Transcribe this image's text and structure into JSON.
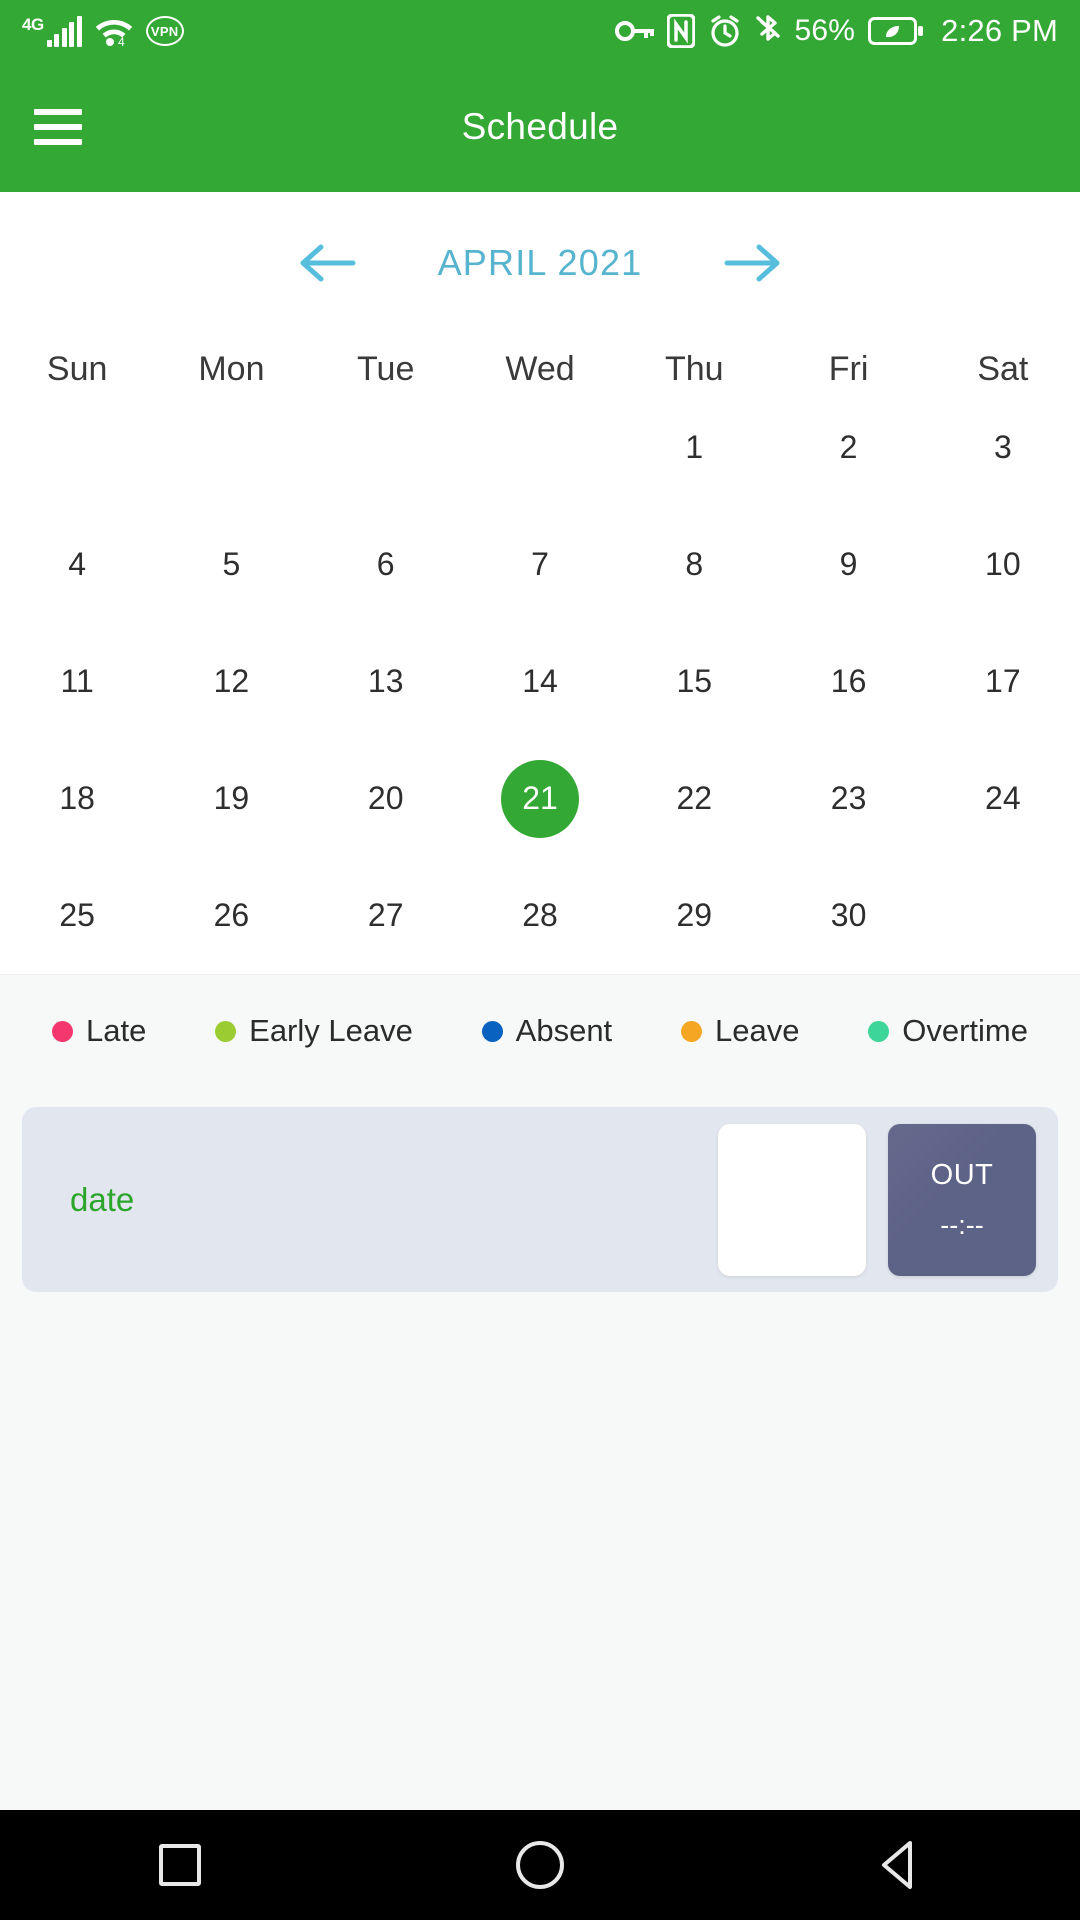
{
  "status_bar": {
    "network_type": "4G",
    "signal_icon": "signal-bars-icon",
    "wifi_icon": "wifi-icon",
    "wifi_badge": "4",
    "vpn_label": "VPN",
    "key_icon": "vpn-key-icon",
    "nfc_icon": "nfc-icon",
    "alarm_icon": "alarm-clock-icon",
    "bluetooth_icon": "bluetooth-icon",
    "battery_percent": "56%",
    "battery_icon": "battery-saver-leaf-icon",
    "time": "2:26 PM"
  },
  "app_bar": {
    "menu_icon": "hamburger-menu-icon",
    "title": "Schedule",
    "background_color": "#34A834"
  },
  "calendar": {
    "prev_icon": "arrow-left-icon",
    "next_icon": "arrow-right-icon",
    "month_label": "APRIL 2021",
    "month_color": "#56B4CE",
    "weekdays": [
      "Sun",
      "Mon",
      "Tue",
      "Wed",
      "Thu",
      "Fri",
      "Sat"
    ],
    "today": 21,
    "today_highlight_color": "#34A834",
    "weeks": [
      [
        "",
        "",
        "",
        "",
        "1",
        "2",
        "3"
      ],
      [
        "4",
        "5",
        "6",
        "7",
        "8",
        "9",
        "10"
      ],
      [
        "11",
        "12",
        "13",
        "14",
        "15",
        "16",
        "17"
      ],
      [
        "18",
        "19",
        "20",
        "21",
        "22",
        "23",
        "24"
      ],
      [
        "25",
        "26",
        "27",
        "28",
        "29",
        "30",
        ""
      ]
    ]
  },
  "legend": [
    {
      "label": "Late",
      "color": "#F4376D"
    },
    {
      "label": "Early Leave",
      "color": "#9BCC32"
    },
    {
      "label": "Absent",
      "color": "#0A62C0"
    },
    {
      "label": "Leave",
      "color": "#F5A623"
    },
    {
      "label": "Overtime",
      "color": "#3DD598"
    }
  ],
  "attendance": {
    "date_label": "date",
    "date_label_color": "#2BA52B",
    "in": {
      "title": "",
      "value": ""
    },
    "out": {
      "title": "OUT",
      "value": "--:--",
      "color": "#5D6287"
    }
  },
  "nav_bar": {
    "recent_icon": "square-recents-icon",
    "home_icon": "circle-home-icon",
    "back_icon": "triangle-back-icon"
  }
}
